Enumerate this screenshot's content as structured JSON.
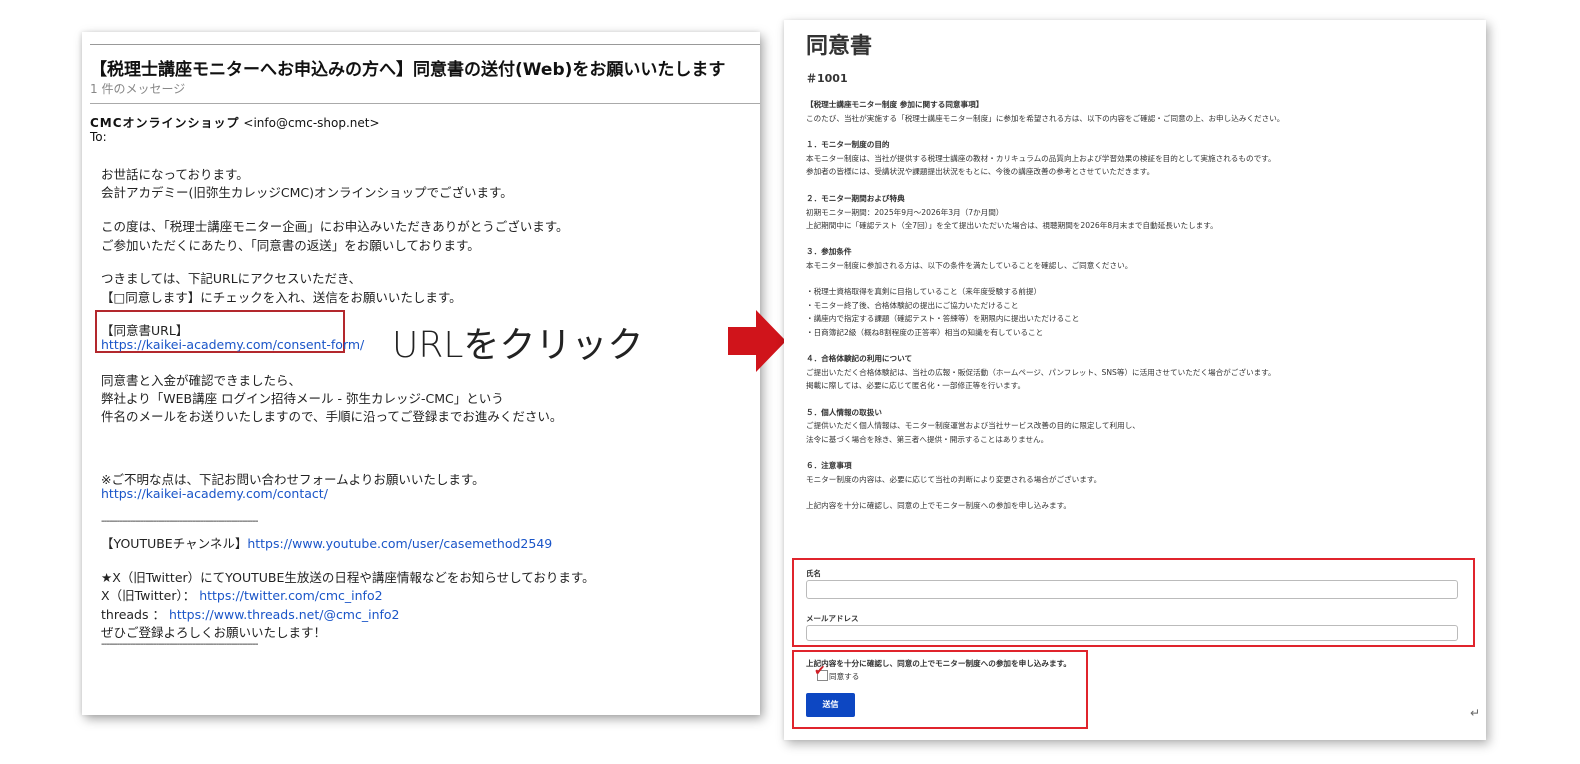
{
  "email": {
    "subject": "【税理士講座モニターへお申込みの方へ】同意書の送付(Web)をお願いいたします",
    "message_count": "1 件のメッセージ",
    "sender_name": "CMCオンラインショップ",
    "sender_email": "<info@cmc-shop.net>",
    "to_label": "To:",
    "greeting1": "お世話になっております。",
    "greeting2": "会計アカデミー(旧弥生カレッジCMC)オンラインショップでございます。",
    "thanks1": "この度は、「税理士講座モニター企画」にお申込みいただきありがとうございます。",
    "thanks2": "ご参加いただくにあたり、「同意書の返送」をお願いしております。",
    "instruct1": "つきましては、下記URLにアクセスいただき、",
    "instruct2": "【□同意します】にチェックを入れ、送信をお願いいたします。",
    "url_label": "【同意書URL】",
    "url": "https://kaikei-academy.com/consent-form/",
    "after1": "同意書と入金が確認できましたら、",
    "after2": "弊社より「WEB講座 ログイン招待メール - 弥生カレッジ-CMC」という",
    "after3": "件名のメールをお送りいたしますので、手順に沿ってご登録までお進みください。",
    "contact_text": "※ご不明な点は、下記お問い合わせフォームよりお願いいたします。",
    "contact_url": "https://kaikei-academy.com/contact/",
    "divider": "------------------------------------------------------------",
    "youtube_label": "【YOUTUBEチャンネル】",
    "youtube_url": "https://www.youtube.com/user/casemethod2549",
    "x_notice": "★X（旧Twitter）にてYOUTUBE生放送の日程や講座情報などをお知らせしております。",
    "x_label": "X（旧Twitter）：",
    "x_url": "https://twitter.com/cmc_info2",
    "threads_label": "threads ：",
    "threads_url": "https://www.threads.net/@cmc_info2",
    "closing": "ぜひご登録よろしくお願いいたします！"
  },
  "annotation": "URLをクリック",
  "form": {
    "title": "同意書",
    "doc_number": "＃1001",
    "heading": "【税理士講座モニター制度 参加に関する同意事項】",
    "intro": "このたび、当社が実施する「税理士講座モニター制度」に参加を希望される方は、以下の内容をご確認・ご同意の上、お申し込みください。",
    "s1_title": "１．モニター制度の目的",
    "s1_l1": "本モニター制度は、当社が提供する税理士講座の教材・カリキュラムの品質向上および学習効果の検証を目的として実施されるものです。",
    "s1_l2": "参加者の皆様には、受講状況や課題提出状況をもとに、今後の講座改善の参考とさせていただきます。",
    "s2_title": "２．モニター期間および特典",
    "s2_l1": "初期モニター期間：2025年9月〜2026年3月（7か月間）",
    "s2_l2": "上記期間中に「確認テスト（全7回）」を全て提出いただいた場合は、視聴期間を2026年8月末まで自動延長いたします。",
    "s3_title": "３．参加条件",
    "s3_l1": "本モニター制度に参加される方は、以下の条件を満たしていることを確認し、ご同意ください。",
    "s3_b1": "・税理士資格取得を真剣に目指していること（来年度受験する前提）",
    "s3_b2": "・モニター終了後、合格体験記の提出にご協力いただけること",
    "s3_b3": "・講座内で指定する課題（確認テスト・答練等）を期限内に提出いただけること",
    "s3_b4": "・日商簿記2級（概ね8割程度の正答率）相当の知識を有していること",
    "s4_title": "４．合格体験記の利用について",
    "s4_l1": "ご提出いただく合格体験記は、当社の広報・販促活動（ホームページ、パンフレット、SNS等）に活用させていただく場合がございます。",
    "s4_l2": "掲載に際しては、必要に応じて匿名化・一部修正等を行います。",
    "s5_title": "５．個人情報の取扱い",
    "s5_l1": "ご提供いただく個人情報は、モニター制度運営および当社サービス改善の目的に限定して利用し、",
    "s5_l2": "法令に基づく場合を除き、第三者へ提供・開示することはありません。",
    "s6_title": "６．注意事項",
    "s6_l1": "モニター制度の内容は、必要に応じて当社の判断により変更される場合がございます。",
    "confirm": "上記内容を十分に確認し、同意の上でモニター制度への参加を申し込みます。",
    "name_label": "氏名",
    "email_label": "メールアドレス",
    "agree_text": "上記内容を十分に確認し、同意の上でモニター制度への参加を申し込みます。",
    "checkbox_label": "同意する",
    "submit_label": "送信",
    "return_glyph": "↵"
  },
  "colors": {
    "link": "#1a55c8",
    "highlight_box": "#e0242c",
    "arrow": "#d0141b",
    "submit": "#0d47c2"
  }
}
